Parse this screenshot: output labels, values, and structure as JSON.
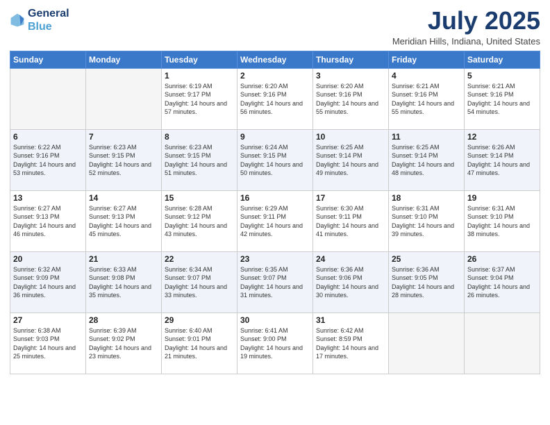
{
  "logo": {
    "line1": "General",
    "line2": "Blue"
  },
  "title": "July 2025",
  "location": "Meridian Hills, Indiana, United States",
  "weekdays": [
    "Sunday",
    "Monday",
    "Tuesday",
    "Wednesday",
    "Thursday",
    "Friday",
    "Saturday"
  ],
  "weeks": [
    [
      {
        "day": "",
        "empty": true
      },
      {
        "day": "",
        "empty": true
      },
      {
        "day": "1",
        "sunrise": "Sunrise: 6:19 AM",
        "sunset": "Sunset: 9:17 PM",
        "daylight": "Daylight: 14 hours and 57 minutes."
      },
      {
        "day": "2",
        "sunrise": "Sunrise: 6:20 AM",
        "sunset": "Sunset: 9:16 PM",
        "daylight": "Daylight: 14 hours and 56 minutes."
      },
      {
        "day": "3",
        "sunrise": "Sunrise: 6:20 AM",
        "sunset": "Sunset: 9:16 PM",
        "daylight": "Daylight: 14 hours and 55 minutes."
      },
      {
        "day": "4",
        "sunrise": "Sunrise: 6:21 AM",
        "sunset": "Sunset: 9:16 PM",
        "daylight": "Daylight: 14 hours and 55 minutes."
      },
      {
        "day": "5",
        "sunrise": "Sunrise: 6:21 AM",
        "sunset": "Sunset: 9:16 PM",
        "daylight": "Daylight: 14 hours and 54 minutes."
      }
    ],
    [
      {
        "day": "6",
        "sunrise": "Sunrise: 6:22 AM",
        "sunset": "Sunset: 9:16 PM",
        "daylight": "Daylight: 14 hours and 53 minutes."
      },
      {
        "day": "7",
        "sunrise": "Sunrise: 6:23 AM",
        "sunset": "Sunset: 9:15 PM",
        "daylight": "Daylight: 14 hours and 52 minutes."
      },
      {
        "day": "8",
        "sunrise": "Sunrise: 6:23 AM",
        "sunset": "Sunset: 9:15 PM",
        "daylight": "Daylight: 14 hours and 51 minutes."
      },
      {
        "day": "9",
        "sunrise": "Sunrise: 6:24 AM",
        "sunset": "Sunset: 9:15 PM",
        "daylight": "Daylight: 14 hours and 50 minutes."
      },
      {
        "day": "10",
        "sunrise": "Sunrise: 6:25 AM",
        "sunset": "Sunset: 9:14 PM",
        "daylight": "Daylight: 14 hours and 49 minutes."
      },
      {
        "day": "11",
        "sunrise": "Sunrise: 6:25 AM",
        "sunset": "Sunset: 9:14 PM",
        "daylight": "Daylight: 14 hours and 48 minutes."
      },
      {
        "day": "12",
        "sunrise": "Sunrise: 6:26 AM",
        "sunset": "Sunset: 9:14 PM",
        "daylight": "Daylight: 14 hours and 47 minutes."
      }
    ],
    [
      {
        "day": "13",
        "sunrise": "Sunrise: 6:27 AM",
        "sunset": "Sunset: 9:13 PM",
        "daylight": "Daylight: 14 hours and 46 minutes."
      },
      {
        "day": "14",
        "sunrise": "Sunrise: 6:27 AM",
        "sunset": "Sunset: 9:13 PM",
        "daylight": "Daylight: 14 hours and 45 minutes."
      },
      {
        "day": "15",
        "sunrise": "Sunrise: 6:28 AM",
        "sunset": "Sunset: 9:12 PM",
        "daylight": "Daylight: 14 hours and 43 minutes."
      },
      {
        "day": "16",
        "sunrise": "Sunrise: 6:29 AM",
        "sunset": "Sunset: 9:11 PM",
        "daylight": "Daylight: 14 hours and 42 minutes."
      },
      {
        "day": "17",
        "sunrise": "Sunrise: 6:30 AM",
        "sunset": "Sunset: 9:11 PM",
        "daylight": "Daylight: 14 hours and 41 minutes."
      },
      {
        "day": "18",
        "sunrise": "Sunrise: 6:31 AM",
        "sunset": "Sunset: 9:10 PM",
        "daylight": "Daylight: 14 hours and 39 minutes."
      },
      {
        "day": "19",
        "sunrise": "Sunrise: 6:31 AM",
        "sunset": "Sunset: 9:10 PM",
        "daylight": "Daylight: 14 hours and 38 minutes."
      }
    ],
    [
      {
        "day": "20",
        "sunrise": "Sunrise: 6:32 AM",
        "sunset": "Sunset: 9:09 PM",
        "daylight": "Daylight: 14 hours and 36 minutes."
      },
      {
        "day": "21",
        "sunrise": "Sunrise: 6:33 AM",
        "sunset": "Sunset: 9:08 PM",
        "daylight": "Daylight: 14 hours and 35 minutes."
      },
      {
        "day": "22",
        "sunrise": "Sunrise: 6:34 AM",
        "sunset": "Sunset: 9:07 PM",
        "daylight": "Daylight: 14 hours and 33 minutes."
      },
      {
        "day": "23",
        "sunrise": "Sunrise: 6:35 AM",
        "sunset": "Sunset: 9:07 PM",
        "daylight": "Daylight: 14 hours and 31 minutes."
      },
      {
        "day": "24",
        "sunrise": "Sunrise: 6:36 AM",
        "sunset": "Sunset: 9:06 PM",
        "daylight": "Daylight: 14 hours and 30 minutes."
      },
      {
        "day": "25",
        "sunrise": "Sunrise: 6:36 AM",
        "sunset": "Sunset: 9:05 PM",
        "daylight": "Daylight: 14 hours and 28 minutes."
      },
      {
        "day": "26",
        "sunrise": "Sunrise: 6:37 AM",
        "sunset": "Sunset: 9:04 PM",
        "daylight": "Daylight: 14 hours and 26 minutes."
      }
    ],
    [
      {
        "day": "27",
        "sunrise": "Sunrise: 6:38 AM",
        "sunset": "Sunset: 9:03 PM",
        "daylight": "Daylight: 14 hours and 25 minutes."
      },
      {
        "day": "28",
        "sunrise": "Sunrise: 6:39 AM",
        "sunset": "Sunset: 9:02 PM",
        "daylight": "Daylight: 14 hours and 23 minutes."
      },
      {
        "day": "29",
        "sunrise": "Sunrise: 6:40 AM",
        "sunset": "Sunset: 9:01 PM",
        "daylight": "Daylight: 14 hours and 21 minutes."
      },
      {
        "day": "30",
        "sunrise": "Sunrise: 6:41 AM",
        "sunset": "Sunset: 9:00 PM",
        "daylight": "Daylight: 14 hours and 19 minutes."
      },
      {
        "day": "31",
        "sunrise": "Sunrise: 6:42 AM",
        "sunset": "Sunset: 8:59 PM",
        "daylight": "Daylight: 14 hours and 17 minutes."
      },
      {
        "day": "",
        "empty": true
      },
      {
        "day": "",
        "empty": true
      }
    ]
  ]
}
